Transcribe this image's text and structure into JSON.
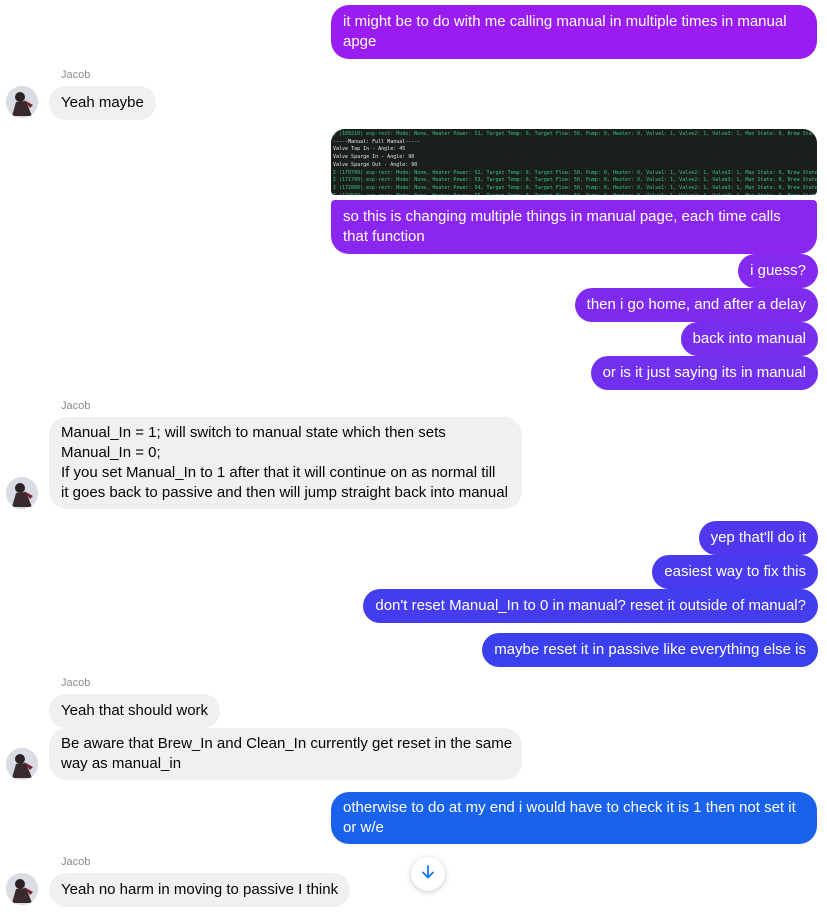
{
  "conversation": {
    "contact_name": "Jacob",
    "messages": [
      {
        "id": "m1",
        "side": "out",
        "text": "it might be to do with me calling manual in multiple times in manual apge",
        "color": "#9a1cf0"
      },
      {
        "id": "m2",
        "side": "in",
        "text": "Yeah maybe"
      },
      {
        "id": "m3",
        "side": "out",
        "text": "so this is changing multiple things in manual page, each time calls that function",
        "color": "#8a26f0"
      },
      {
        "id": "m4",
        "side": "out",
        "text": "i guess?",
        "color": "#8429ef"
      },
      {
        "id": "m5",
        "side": "out",
        "text": "then i go home, and after a delay",
        "color": "#7e2bef"
      },
      {
        "id": "m6",
        "side": "out",
        "text": "back into manual",
        "color": "#772eee"
      },
      {
        "id": "m7",
        "side": "out",
        "text": "or is it just saying its in manual",
        "color": "#7030ee"
      },
      {
        "id": "m8",
        "side": "in",
        "lines": [
          "Manual_In = 1; will switch to manual state which then sets",
          "Manual_In = 0;",
          "If you set Manual_In to 1 after that it will continue on as normal till",
          "it goes back to passive and then will jump straight back into manual"
        ]
      },
      {
        "id": "m9",
        "side": "out",
        "text": "yep that'll do it",
        "color": "#5038ee"
      },
      {
        "id": "m10",
        "side": "out",
        "text": "easiest way to fix this",
        "color": "#4a3aee"
      },
      {
        "id": "m11",
        "side": "out",
        "text": "don't reset Manual_In to 0 in manual? reset it outside of manual?",
        "color": "#433ded"
      },
      {
        "id": "m12",
        "side": "out",
        "text": "maybe reset it in passive like everything else is",
        "color": "#3a40ed"
      },
      {
        "id": "m13",
        "side": "in",
        "text": "Yeah that should work"
      },
      {
        "id": "m14",
        "side": "in",
        "lines": [
          "Be aware that Brew_In and Clean_In currently get reset in the same",
          "way as manual_in"
        ]
      },
      {
        "id": "m15",
        "side": "out",
        "lines": [
          "otherwise to do at my end i would have to check it is 1 then not set it",
          "or w/e"
        ],
        "color": "#1a62ec"
      },
      {
        "id": "m16",
        "side": "in",
        "text": "Yeah no harm in moving to passive I think"
      }
    ],
    "attachment": {
      "type": "terminal-screenshot",
      "lines": [
        "I (169210) esp-rest: Mode: None, Heater Power: 51, Target Temp: 0, Target Flow: 50, Pump: 0, Heater: 0, Valve1: 1, Valve2: 1, Valve3: 1, Man State: 0, Brew State: 2",
        "-----Manual: Full Manual-----",
        "Valve Tap In - Angle: 45",
        "Valve Sparge In - Angle: 90",
        "Valve Sparge Out - Angle: 90",
        "I (170700) esp-rest: Mode: None, Heater Power: 52, Target Temp: 0, Target Flow: 50, Pump: 0, Heater: 0, Valve1: 1, Valve2: 1, Valve3: 1, Man State: 0, Brew State: 2",
        "I (171700) esp-rest: Mode: None, Heater Power: 53, Target Temp: 0, Target Flow: 50, Pump: 0, Heater: 0, Valve1: 1, Valve2: 1, Valve3: 1, Man State: 0, Brew State: 2",
        "I (172800) esp-rest: Mode: None, Heater Power: 54, Target Temp: 0, Target Flow: 50, Pump: 0, Heater: 0, Valve1: 1, Valve2: 1, Valve3: 1, Man State: 0, Brew State: 2",
        "I (174560) esp-rest: Mode: None, Heater Power: 55, Target Temp: 0, Target Flow: 50, Pump: 0, Heater: 0, Valve1: 1, Valve2: 1, Valve3: 1, Man State: 0, Brew State: 2"
      ]
    },
    "icons": {
      "scroll_down": "arrow-down-icon"
    },
    "colors": {
      "incoming_bubble": "#f0f0f0",
      "sender_name": "#8a8d91",
      "terminal_bg": "#1b1f1c",
      "terminal_text": "#39c27a"
    }
  }
}
